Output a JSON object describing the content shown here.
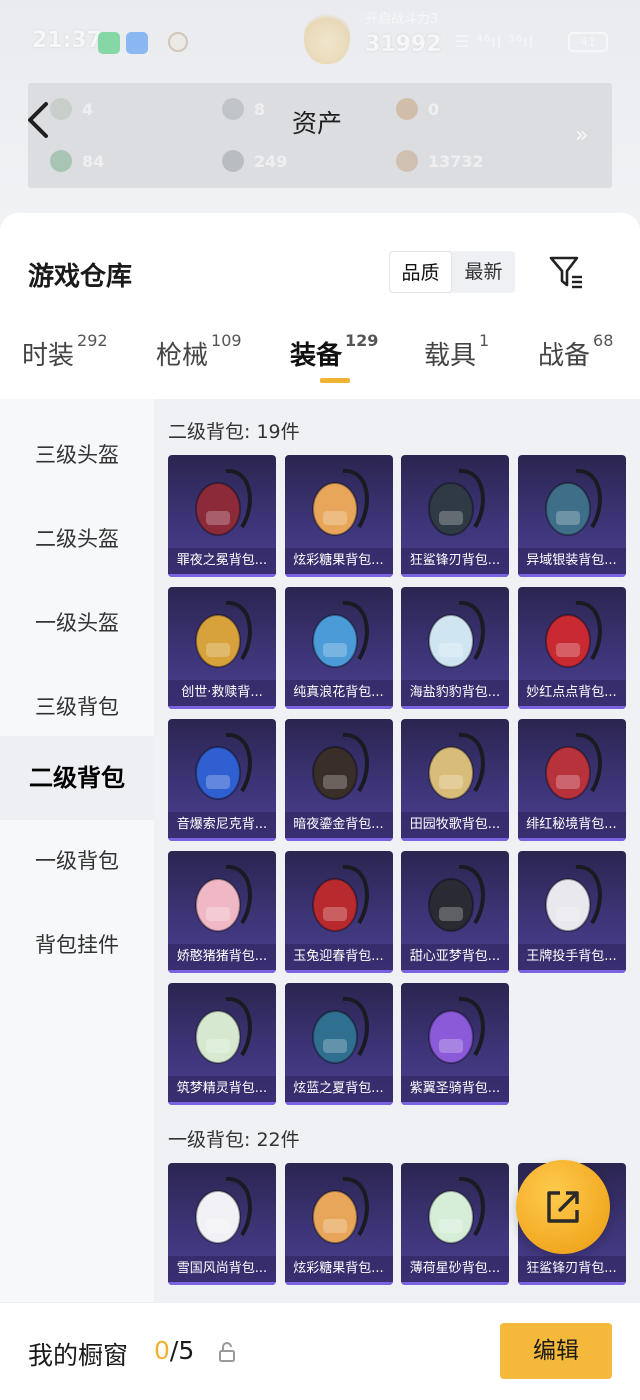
{
  "status_bar": {
    "time": "21:37",
    "center_text": "开启战斗力3",
    "score": "31992",
    "right_text": "☰ ⁴⁶ıl ⁵⁶ıl",
    "battery": "41"
  },
  "assets": {
    "title": "资产",
    "items": [
      {
        "value": "4",
        "icon": "gem-icon",
        "color": "#b9c2b7"
      },
      {
        "value": "8",
        "icon": "gear-coin-icon",
        "color": "#aab0b6"
      },
      {
        "value": "0",
        "icon": "bronze-coin-icon",
        "color": "#c9a57b"
      },
      {
        "value": "84",
        "icon": "green-gem-icon",
        "color": "#7fb08f"
      },
      {
        "value": "249",
        "icon": "silver-coin-icon",
        "color": "#9ea4aa"
      },
      {
        "value": "13732",
        "icon": "gold-coin-icon",
        "color": "#c7a98a"
      }
    ]
  },
  "warehouse": {
    "title": "游戏仓库",
    "sort_options": [
      "品质",
      "最新"
    ],
    "sort_selected": "品质",
    "filter_icon": "filter-icon"
  },
  "tabs": [
    {
      "label": "时装",
      "count": "292"
    },
    {
      "label": "枪械",
      "count": "109"
    },
    {
      "label": "装备",
      "count": "129",
      "active": true
    },
    {
      "label": "载具",
      "count": "1"
    },
    {
      "label": "战备",
      "count": "68"
    }
  ],
  "side_nav": [
    {
      "label": "三级头盔"
    },
    {
      "label": "二级头盔"
    },
    {
      "label": "一级头盔"
    },
    {
      "label": "三级背包"
    },
    {
      "label": "二级背包",
      "active": true
    },
    {
      "label": "一级背包"
    },
    {
      "label": "背包挂件"
    }
  ],
  "sections": [
    {
      "title": "二级背包: 19件",
      "items": [
        {
          "name": "罪夜之冕背包...",
          "color": "#8c2a3a"
        },
        {
          "name": "炫彩糖果背包...",
          "color": "#e7a65a"
        },
        {
          "name": "狂鲨锋刃背包...",
          "color": "#2f3a44"
        },
        {
          "name": "异域银装背包...",
          "color": "#3f6f88"
        },
        {
          "name": "创世·救赎背...",
          "color": "#d7a23c"
        },
        {
          "name": "纯真浪花背包...",
          "color": "#4a9bd8"
        },
        {
          "name": "海盐豹豹背包...",
          "color": "#cfe6f2"
        },
        {
          "name": "妙红点点背包...",
          "color": "#c92a32"
        },
        {
          "name": "音爆索尼克背...",
          "color": "#2f5fd0"
        },
        {
          "name": "暗夜鎏金背包...",
          "color": "#3a2e28"
        },
        {
          "name": "田园牧歌背包...",
          "color": "#d8bc7a"
        },
        {
          "name": "绯红秘境背包...",
          "color": "#b8323c"
        },
        {
          "name": "娇憨猪猪背包...",
          "color": "#f0b8c4"
        },
        {
          "name": "玉兔迎春背包...",
          "color": "#b82a2e"
        },
        {
          "name": "甜心亚梦背包...",
          "color": "#2a2a33"
        },
        {
          "name": "王牌投手背包...",
          "color": "#e8e8ee"
        },
        {
          "name": "筑梦精灵背包...",
          "color": "#d6e8d0"
        },
        {
          "name": "炫蓝之夏背包...",
          "color": "#2f6f8f"
        },
        {
          "name": "紫翼圣骑背包...",
          "color": "#8a5ad8"
        }
      ]
    },
    {
      "title": "一级背包: 22件",
      "items": [
        {
          "name": "雪国风尚背包...",
          "color": "#f2f2f6"
        },
        {
          "name": "炫彩糖果背包...",
          "color": "#e7a65a"
        },
        {
          "name": "薄荷星砂背包...",
          "color": "#d6eed8"
        },
        {
          "name": "狂鲨锋刃背包...",
          "color": "#2f3a44"
        }
      ]
    }
  ],
  "fab": {
    "icon": "share-icon"
  },
  "showcase": {
    "label": "我的橱窗",
    "current": "0",
    "total": "/5",
    "edit_label": "编辑"
  }
}
